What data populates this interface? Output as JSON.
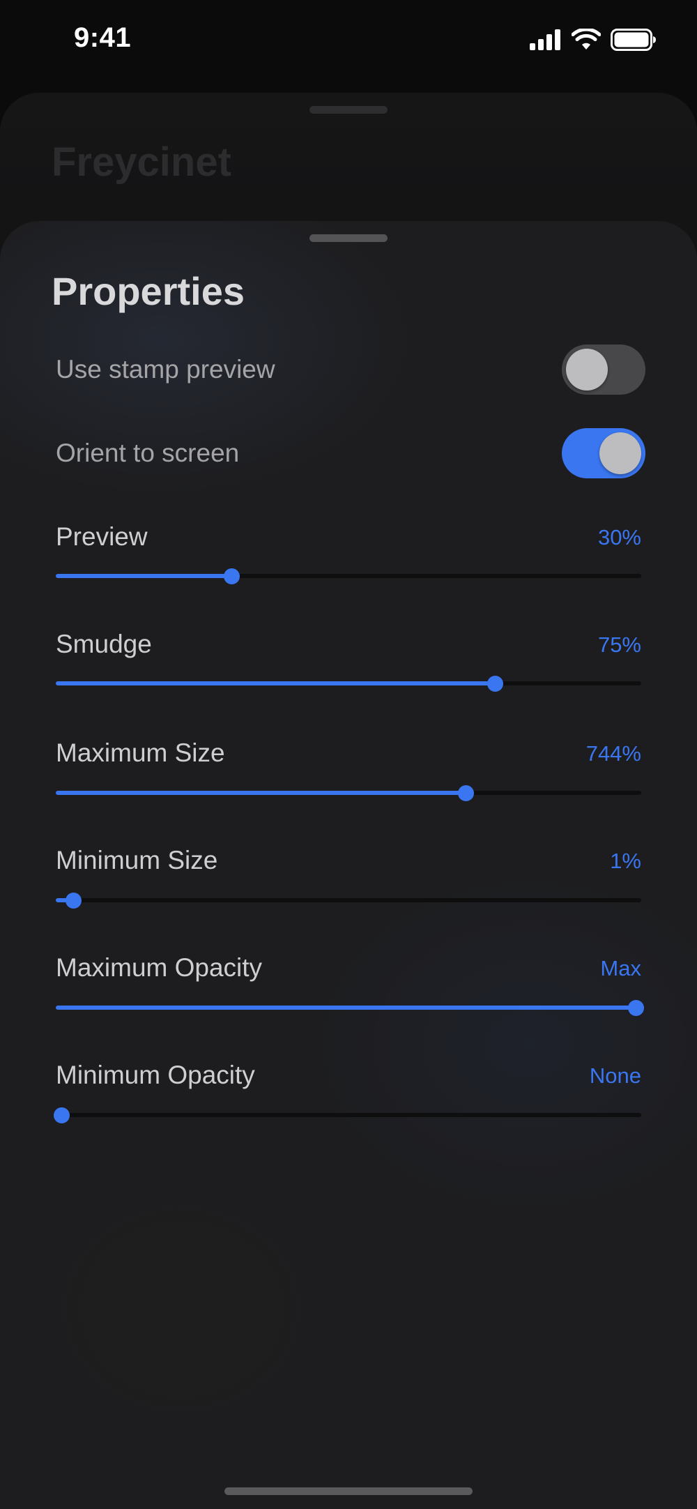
{
  "status_bar": {
    "time": "9:41",
    "icons": [
      "cellular-signal-icon",
      "wifi-icon",
      "battery-icon"
    ]
  },
  "back_sheet": {
    "title": "Freycinet"
  },
  "sheet": {
    "title": "Properties",
    "toggles": [
      {
        "label": "Use stamp preview",
        "on": false
      },
      {
        "label": "Orient to screen",
        "on": true
      }
    ],
    "sliders": [
      {
        "label": "Preview",
        "value_text": "30%",
        "level": 0.3
      },
      {
        "label": "Smudge",
        "value_text": "75%",
        "level": 0.75
      },
      {
        "label": "Maximum Size",
        "value_text": "744%",
        "level": 0.7
      },
      {
        "label": "Minimum Size",
        "value_text": "1%",
        "level": 0.03
      },
      {
        "label": "Maximum Opacity",
        "value_text": "Max",
        "level": 0.99
      },
      {
        "label": "Minimum Opacity",
        "value_text": "None",
        "level": 0.01
      }
    ]
  },
  "colors": {
    "accent": "#3a76f0",
    "sheet_background": "#1d1d1f",
    "toggle_off": "#48484b"
  }
}
